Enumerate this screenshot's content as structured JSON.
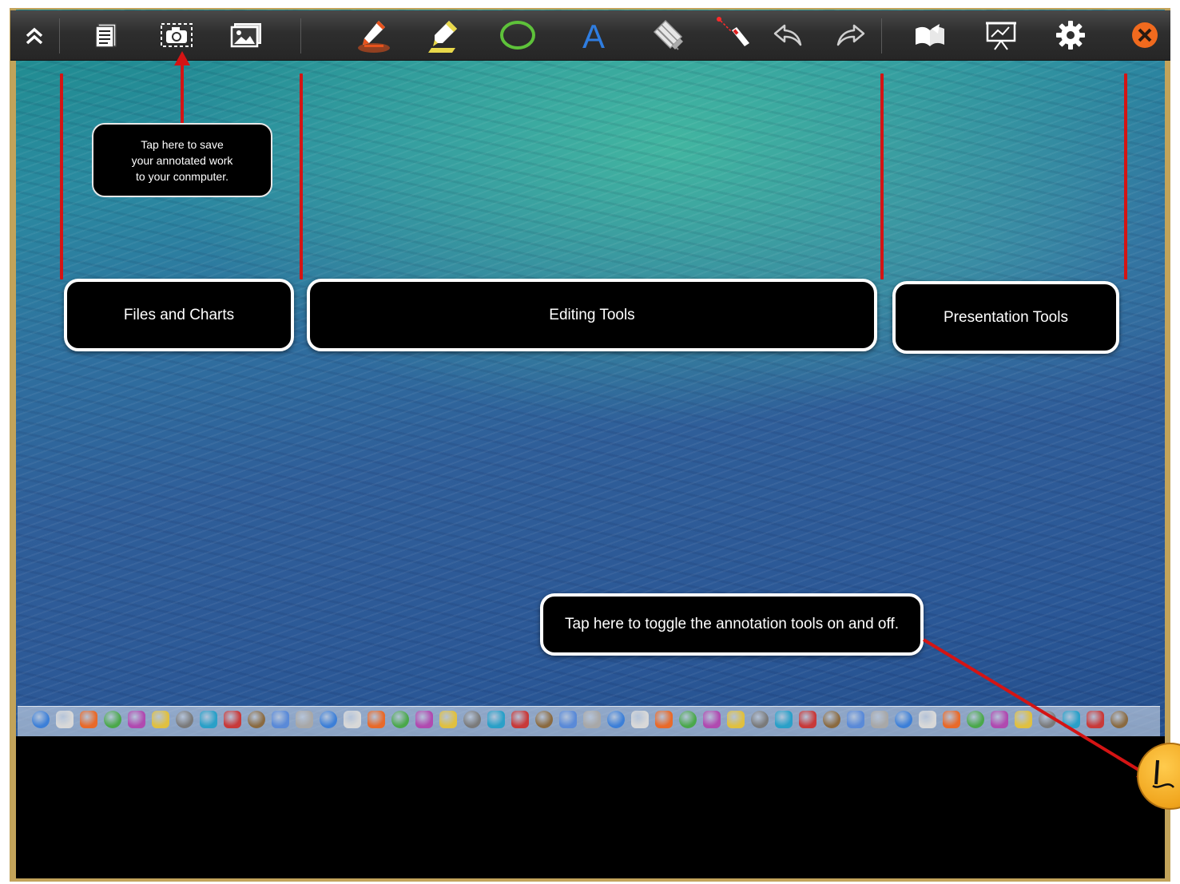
{
  "toolbar": {
    "buttons": [
      {
        "name": "collapse-toolbar",
        "icon": "double-chevron-up-icon"
      },
      {
        "name": "files",
        "icon": "document-list-icon"
      },
      {
        "name": "save-screenshot",
        "icon": "camera-icon"
      },
      {
        "name": "insert-image",
        "icon": "image-icon"
      },
      {
        "name": "pen",
        "icon": "pencil-icon"
      },
      {
        "name": "highlighter",
        "icon": "highlighter-icon"
      },
      {
        "name": "shape",
        "icon": "circle-icon"
      },
      {
        "name": "text",
        "icon": "text-a-icon",
        "glyph": "A"
      },
      {
        "name": "eraser",
        "icon": "eraser-icon"
      },
      {
        "name": "laser-pointer",
        "icon": "laser-pointer-icon"
      },
      {
        "name": "undo",
        "icon": "undo-arrow-icon"
      },
      {
        "name": "redo",
        "icon": "redo-arrow-icon"
      },
      {
        "name": "whiteboard",
        "icon": "book-icon"
      },
      {
        "name": "presentation",
        "icon": "presentation-board-icon"
      },
      {
        "name": "settings",
        "icon": "gear-icon"
      },
      {
        "name": "close",
        "icon": "close-icon"
      }
    ]
  },
  "callouts": {
    "save_tip": {
      "lines": [
        "Tap here to save",
        "your annotated work",
        "to your conmputer."
      ]
    },
    "files_and_charts": "Files and Charts",
    "editing_tools": "Editing Tools",
    "presentation_tools": "Presentation Tools",
    "toggle_tip": "Tap here to toggle the annotation tools on and off."
  },
  "colors": {
    "toolbar_bg": "#2e2e2e",
    "callout_line": "#d41414",
    "pen_accent": "#e8531c",
    "highlighter_accent": "#e8d84a",
    "shape_accent": "#5ec23a",
    "text_accent": "#2f7de0",
    "close_accent": "#f06a1e",
    "toggle_accent": "#f0a41c"
  },
  "dock": {
    "icon_count": 46
  }
}
